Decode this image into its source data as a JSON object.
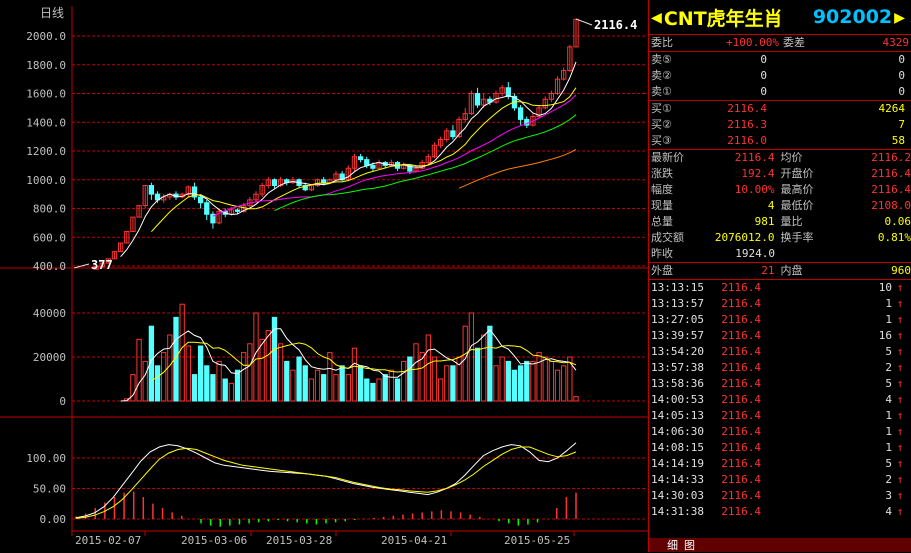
{
  "chart": {
    "period_label": "日线",
    "latest_label": "2116.4",
    "low_label": "377",
    "price_ticks": [
      "2000.0",
      "1800.0",
      "1600.0",
      "1400.0",
      "1200.0",
      "1000.0",
      "800.0",
      "600.0",
      "400.0"
    ],
    "price_range": [
      400,
      2000
    ],
    "vol_ticks": [
      "40000",
      "20000",
      "0"
    ],
    "vol_range": [
      0,
      40000
    ],
    "osc_ticks": [
      "100.00",
      "50.00",
      "0.00"
    ],
    "osc_range": [
      0,
      100
    ],
    "date_ticks": [
      "2015-02-07",
      "2015-03-06",
      "2015-03-28",
      "2015-04-21",
      "2015-05-25"
    ],
    "colors": {
      "up": "#ff3232",
      "down": "#54ffff",
      "grid": "#c00000",
      "ma5": "#ffffff",
      "ma10": "#ffff00",
      "ma20": "#ff00ff",
      "ma30": "#00ff00",
      "ma60": "#ff8000"
    }
  },
  "chart_data": [
    {
      "type": "candlestick",
      "title": "日线",
      "ylim": [
        400,
        2000
      ],
      "x_ticks": [
        "2015-02-07",
        "2015-03-06",
        "2015-03-28",
        "2015-04-21",
        "2015-05-25"
      ],
      "ohlc": [
        [
          377,
          395,
          377,
          395
        ],
        [
          395,
          420,
          395,
          420
        ],
        [
          420,
          450,
          420,
          450
        ],
        [
          450,
          500,
          450,
          500
        ],
        [
          500,
          560,
          500,
          560
        ],
        [
          560,
          640,
          560,
          640
        ],
        [
          640,
          740,
          640,
          740
        ],
        [
          740,
          820,
          740,
          820
        ],
        [
          820,
          960,
          800,
          960
        ],
        [
          960,
          900,
          860,
          980
        ],
        [
          900,
          860,
          840,
          920
        ],
        [
          860,
          880,
          840,
          900
        ],
        [
          880,
          900,
          860,
          910
        ],
        [
          900,
          880,
          860,
          920
        ],
        [
          880,
          900,
          870,
          910
        ],
        [
          900,
          950,
          880,
          960
        ],
        [
          950,
          880,
          860,
          980
        ],
        [
          880,
          840,
          800,
          900
        ],
        [
          840,
          760,
          720,
          860
        ],
        [
          760,
          700,
          660,
          780
        ],
        [
          700,
          780,
          690,
          800
        ],
        [
          780,
          760,
          740,
          800
        ],
        [
          760,
          790,
          750,
          810
        ],
        [
          790,
          780,
          760,
          800
        ],
        [
          780,
          820,
          770,
          840
        ],
        [
          820,
          860,
          800,
          880
        ],
        [
          860,
          900,
          840,
          920
        ],
        [
          900,
          960,
          880,
          980
        ],
        [
          960,
          1000,
          940,
          1020
        ],
        [
          1000,
          960,
          940,
          1010
        ],
        [
          960,
          1000,
          950,
          1020
        ],
        [
          1000,
          980,
          960,
          1010
        ],
        [
          980,
          1000,
          970,
          1020
        ],
        [
          1000,
          960,
          940,
          1010
        ],
        [
          960,
          930,
          920,
          980
        ],
        [
          930,
          960,
          920,
          970
        ],
        [
          960,
          1000,
          950,
          1010
        ],
        [
          1000,
          980,
          960,
          1020
        ],
        [
          980,
          1000,
          970,
          1010
        ],
        [
          1000,
          1040,
          990,
          1060
        ],
        [
          1040,
          1000,
          990,
          1060
        ],
        [
          1000,
          1080,
          990,
          1100
        ],
        [
          1080,
          1160,
          1060,
          1180
        ],
        [
          1160,
          1140,
          1120,
          1180
        ],
        [
          1140,
          1100,
          1080,
          1160
        ],
        [
          1100,
          1080,
          1060,
          1120
        ],
        [
          1080,
          1120,
          1070,
          1140
        ],
        [
          1120,
          1100,
          1080,
          1130
        ],
        [
          1100,
          1120,
          1090,
          1140
        ],
        [
          1120,
          1080,
          1060,
          1130
        ],
        [
          1080,
          1100,
          1070,
          1120
        ],
        [
          1100,
          1060,
          1040,
          1110
        ],
        [
          1060,
          1080,
          1050,
          1100
        ],
        [
          1080,
          1120,
          1070,
          1140
        ],
        [
          1120,
          1160,
          1100,
          1180
        ],
        [
          1160,
          1240,
          1150,
          1260
        ],
        [
          1240,
          1280,
          1220,
          1300
        ],
        [
          1280,
          1340,
          1260,
          1360
        ],
        [
          1340,
          1300,
          1280,
          1380
        ],
        [
          1300,
          1420,
          1290,
          1440
        ],
        [
          1420,
          1460,
          1400,
          1500
        ],
        [
          1460,
          1600,
          1450,
          1620
        ],
        [
          1600,
          1520,
          1500,
          1640
        ],
        [
          1520,
          1560,
          1500,
          1600
        ],
        [
          1560,
          1540,
          1520,
          1580
        ],
        [
          1540,
          1600,
          1530,
          1620
        ],
        [
          1600,
          1640,
          1580,
          1660
        ],
        [
          1640,
          1580,
          1560,
          1680
        ],
        [
          1580,
          1500,
          1480,
          1600
        ],
        [
          1500,
          1420,
          1380,
          1520
        ],
        [
          1420,
          1380,
          1360,
          1440
        ],
        [
          1380,
          1440,
          1370,
          1460
        ],
        [
          1440,
          1500,
          1430,
          1520
        ],
        [
          1500,
          1560,
          1490,
          1580
        ],
        [
          1560,
          1600,
          1540,
          1620
        ],
        [
          1600,
          1700,
          1590,
          1720
        ],
        [
          1700,
          1760,
          1690,
          1780
        ],
        [
          1760,
          1924,
          1750,
          1940
        ],
        [
          1924,
          2116.4,
          1924,
          2116.4
        ]
      ]
    },
    {
      "type": "bar",
      "title": "",
      "ylim": [
        0,
        44000
      ],
      "values": [
        0,
        0,
        0,
        0,
        0,
        1000,
        12000,
        28000,
        18000,
        34000,
        16000,
        22000,
        30000,
        38000,
        44000,
        25000,
        12000,
        25000,
        16000,
        12000,
        18000,
        10000,
        8000,
        14000,
        22000,
        26000,
        40000,
        28000,
        32000,
        38000,
        26000,
        18000,
        14000,
        20000,
        16000,
        10000,
        14000,
        12000,
        22000,
        12000,
        16000,
        12000,
        24000,
        16000,
        10000,
        8000,
        10000,
        12000,
        14000,
        10000,
        18000,
        20000,
        26000,
        22000,
        30000,
        20000,
        10000,
        16000,
        16000,
        20000,
        34000,
        40000,
        24000,
        30000,
        34000,
        16000,
        20000,
        18000,
        14000,
        16000,
        18000,
        18000,
        22000,
        20000,
        18000,
        14000,
        16000,
        20000,
        2000
      ]
    },
    {
      "type": "line",
      "title": "",
      "ylim": [
        0,
        150
      ],
      "series": [
        {
          "values": [
            2,
            5,
            10,
            20,
            35,
            55,
            75,
            95,
            110,
            118,
            122,
            120,
            115,
            108,
            100,
            92,
            88,
            86,
            84,
            82,
            80,
            78,
            77,
            76,
            75,
            74,
            72,
            70,
            66,
            62,
            58,
            55,
            52,
            50,
            48,
            46,
            44,
            42,
            40,
            44,
            50,
            58,
            72,
            88,
            104,
            112,
            118,
            122,
            120,
            110,
            96,
            94,
            100,
            112,
            125
          ]
        },
        {
          "values": [
            1,
            3,
            6,
            12,
            20,
            32,
            48,
            65,
            82,
            98,
            108,
            114,
            116,
            114,
            108,
            102,
            96,
            92,
            88,
            86,
            84,
            82,
            80,
            78,
            76,
            74,
            72,
            70,
            68,
            64,
            60,
            57,
            54,
            51,
            49,
            48,
            46,
            45,
            44,
            46,
            50,
            56,
            64,
            74,
            86,
            96,
            106,
            114,
            118,
            118,
            112,
            106,
            102,
            104,
            110
          ]
        }
      ],
      "bars": [
        5,
        10,
        20,
        30,
        40,
        48,
        50,
        40,
        28,
        20,
        12,
        6,
        0,
        -8,
        -12,
        -14,
        -12,
        -10,
        -8,
        -6,
        -4,
        -2,
        -4,
        -6,
        -8,
        -10,
        -8,
        -6,
        -4,
        -2,
        0,
        2,
        4,
        6,
        8,
        10,
        12,
        14,
        16,
        14,
        12,
        8,
        4,
        0,
        -4,
        -8,
        -12,
        -10,
        -6,
        0,
        20,
        40,
        48
      ]
    }
  ],
  "panel": {
    "name": "CNT虎年生肖",
    "code": "902002",
    "weibi_label": "委比",
    "weibi": "+100.00%",
    "weicha_label": "委差",
    "weicha": "4329",
    "sells": [
      {
        "label": "卖⑤",
        "price": "0",
        "vol": "0"
      },
      {
        "label": "卖②",
        "price": "0",
        "vol": "0"
      },
      {
        "label": "卖①",
        "price": "0",
        "vol": "0"
      }
    ],
    "buys": [
      {
        "label": "买①",
        "price": "2116.4",
        "vol": "4264"
      },
      {
        "label": "买②",
        "price": "2116.3",
        "vol": "7"
      },
      {
        "label": "买③",
        "price": "2116.0",
        "vol": "58"
      }
    ],
    "quote": [
      {
        "l1": "最新价",
        "v1": "2116.4",
        "l2": "均价",
        "v2": "2116.2"
      },
      {
        "l1": "涨跌",
        "v1": "192.4",
        "l2": "开盘价",
        "v2": "2116.4"
      },
      {
        "l1": "幅度",
        "v1": "10.00%",
        "l2": "最高价",
        "v2": "2116.4"
      },
      {
        "l1": "现量",
        "v1": "4",
        "l2": "最低价",
        "v2": "2108.0"
      },
      {
        "l1": "总量",
        "v1": "981",
        "l2": "量比",
        "v2": "0.06"
      },
      {
        "l1": "成交额",
        "v1": "2076012.0",
        "l2": "换手率",
        "v2": "0.81%"
      }
    ],
    "prev_close_label": "昨收",
    "prev_close": "1924.0",
    "outer_label": "外盘",
    "outer": "21",
    "inner_label": "内盘",
    "inner": "960",
    "ticks": [
      {
        "t": "13:13:15",
        "p": "2116.4",
        "v": "10",
        "d": "↑"
      },
      {
        "t": "13:13:57",
        "p": "2116.4",
        "v": "1",
        "d": "↑"
      },
      {
        "t": "13:27:05",
        "p": "2116.4",
        "v": "1",
        "d": "↑"
      },
      {
        "t": "13:39:57",
        "p": "2116.4",
        "v": "16",
        "d": "↑"
      },
      {
        "t": "13:54:20",
        "p": "2116.4",
        "v": "5",
        "d": "↑"
      },
      {
        "t": "13:57:38",
        "p": "2116.4",
        "v": "2",
        "d": "↑"
      },
      {
        "t": "13:58:36",
        "p": "2116.4",
        "v": "5",
        "d": "↑"
      },
      {
        "t": "14:00:53",
        "p": "2116.4",
        "v": "4",
        "d": "↑"
      },
      {
        "t": "14:05:13",
        "p": "2116.4",
        "v": "1",
        "d": "↑"
      },
      {
        "t": "14:06:30",
        "p": "2116.4",
        "v": "1",
        "d": "↑"
      },
      {
        "t": "14:08:15",
        "p": "2116.4",
        "v": "1",
        "d": "↑"
      },
      {
        "t": "14:14:19",
        "p": "2116.4",
        "v": "5",
        "d": "↑"
      },
      {
        "t": "14:14:33",
        "p": "2116.4",
        "v": "2",
        "d": "↑"
      },
      {
        "t": "14:30:03",
        "p": "2116.4",
        "v": "3",
        "d": "↑"
      },
      {
        "t": "14:31:38",
        "p": "2116.4",
        "v": "4",
        "d": "↑"
      }
    ],
    "tabs": [
      "细",
      "图"
    ]
  }
}
